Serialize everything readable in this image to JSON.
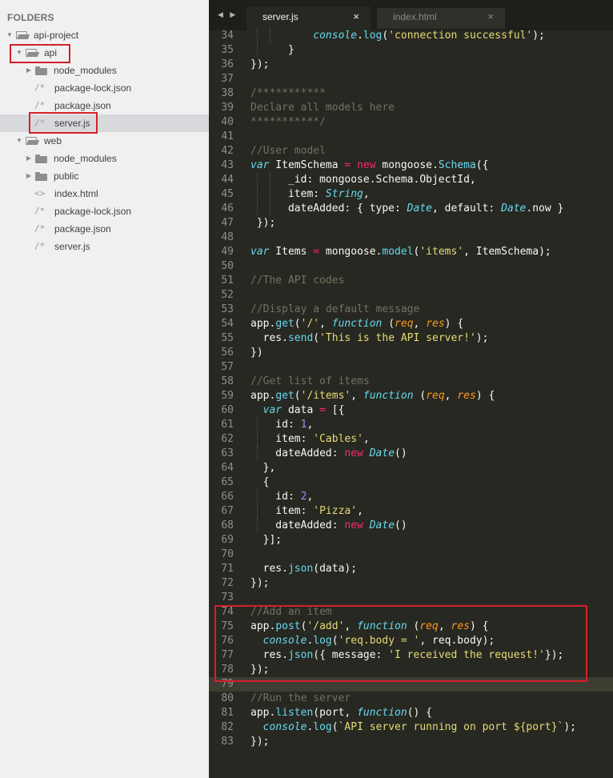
{
  "sidebar": {
    "header": "FOLDERS",
    "items": [
      {
        "label": "api-project",
        "kind": "folder-open",
        "depth": 0
      },
      {
        "label": "api",
        "kind": "folder-open",
        "depth": 1
      },
      {
        "label": "node_modules",
        "kind": "folder-closed",
        "depth": 2
      },
      {
        "label": "package-lock.json",
        "kind": "file",
        "depth": 2
      },
      {
        "label": "package.json",
        "kind": "file",
        "depth": 2
      },
      {
        "label": "server.js",
        "kind": "file",
        "depth": 2,
        "selected": true
      },
      {
        "label": "web",
        "kind": "folder-open",
        "depth": 1
      },
      {
        "label": "node_modules",
        "kind": "folder-closed",
        "depth": 2
      },
      {
        "label": "public",
        "kind": "folder-closed",
        "depth": 2
      },
      {
        "label": "index.html",
        "kind": "html-file",
        "depth": 2
      },
      {
        "label": "package-lock.json",
        "kind": "file",
        "depth": 2
      },
      {
        "label": "package.json",
        "kind": "file",
        "depth": 2
      },
      {
        "label": "server.js",
        "kind": "file",
        "depth": 2
      }
    ]
  },
  "icons": {
    "file": "/*",
    "html_file": "<>",
    "close": "×",
    "nav": "◀ ▶"
  },
  "tabs": [
    {
      "label": "server.js",
      "active": true
    },
    {
      "label": "index.html",
      "active": false
    }
  ],
  "editor": {
    "current_line": "79",
    "lines": [
      {
        "num": "34",
        "tokens": [
          [
            "",
            "          "
          ],
          [
            "it",
            "console"
          ],
          [
            "",
            "."
          ],
          [
            "f",
            "log"
          ],
          [
            "",
            "("
          ],
          [
            "s",
            "'connection successful'"
          ],
          [
            "",
            ");"
          ]
        ]
      },
      {
        "num": "35",
        "tokens": [
          [
            "",
            "      }"
          ]
        ]
      },
      {
        "num": "36",
        "tokens": [
          [
            "",
            "});"
          ]
        ]
      },
      {
        "num": "37",
        "tokens": []
      },
      {
        "num": "38",
        "tokens": [
          [
            "c",
            "/***********"
          ]
        ]
      },
      {
        "num": "39",
        "tokens": [
          [
            "c",
            "Declare all models here"
          ]
        ]
      },
      {
        "num": "40",
        "tokens": [
          [
            "c",
            "***********/"
          ]
        ]
      },
      {
        "num": "41",
        "tokens": []
      },
      {
        "num": "42",
        "tokens": [
          [
            "c",
            "//User model"
          ]
        ]
      },
      {
        "num": "43",
        "tokens": [
          [
            "it",
            "var"
          ],
          [
            "",
            " ItemSchema "
          ],
          [
            "k",
            "="
          ],
          [
            "",
            " "
          ],
          [
            "k",
            "new"
          ],
          [
            "",
            " mongoose."
          ],
          [
            "f",
            "Schema"
          ],
          [
            "",
            "({"
          ]
        ]
      },
      {
        "num": "44",
        "tokens": [
          [
            "",
            "      _id: mongoose.Schema.ObjectId,"
          ]
        ]
      },
      {
        "num": "45",
        "tokens": [
          [
            "",
            "      item: "
          ],
          [
            "it",
            "String"
          ],
          [
            "",
            ","
          ]
        ]
      },
      {
        "num": "46",
        "tokens": [
          [
            "",
            "      dateAdded: { type: "
          ],
          [
            "it",
            "Date"
          ],
          [
            "",
            ", default: "
          ],
          [
            "it",
            "Date"
          ],
          [
            "",
            ".now }"
          ]
        ]
      },
      {
        "num": "47",
        "tokens": [
          [
            "",
            " });"
          ]
        ]
      },
      {
        "num": "48",
        "tokens": []
      },
      {
        "num": "49",
        "tokens": [
          [
            "it",
            "var"
          ],
          [
            "",
            " Items "
          ],
          [
            "k",
            "="
          ],
          [
            "",
            " mongoose."
          ],
          [
            "f",
            "model"
          ],
          [
            "",
            "("
          ],
          [
            "s",
            "'items'"
          ],
          [
            "",
            ", ItemSchema);"
          ]
        ]
      },
      {
        "num": "50",
        "tokens": []
      },
      {
        "num": "51",
        "tokens": [
          [
            "c",
            "//The API codes"
          ]
        ]
      },
      {
        "num": "52",
        "tokens": []
      },
      {
        "num": "53",
        "tokens": [
          [
            "c",
            "//Display a default message"
          ]
        ]
      },
      {
        "num": "54",
        "tokens": [
          [
            "",
            "app."
          ],
          [
            "f",
            "get"
          ],
          [
            "",
            "("
          ],
          [
            "s",
            "'/'"
          ],
          [
            "",
            ", "
          ],
          [
            "it",
            "function"
          ],
          [
            "",
            " ("
          ],
          [
            "p",
            "req"
          ],
          [
            "",
            ", "
          ],
          [
            "p",
            "res"
          ],
          [
            "",
            ") {"
          ]
        ]
      },
      {
        "num": "55",
        "tokens": [
          [
            "",
            "  res."
          ],
          [
            "f",
            "send"
          ],
          [
            "",
            "("
          ],
          [
            "s",
            "'This is the API server!'"
          ],
          [
            "",
            ");"
          ]
        ]
      },
      {
        "num": "56",
        "tokens": [
          [
            "",
            "})"
          ]
        ]
      },
      {
        "num": "57",
        "tokens": []
      },
      {
        "num": "58",
        "tokens": [
          [
            "c",
            "//Get list of items"
          ]
        ]
      },
      {
        "num": "59",
        "tokens": [
          [
            "",
            "app."
          ],
          [
            "f",
            "get"
          ],
          [
            "",
            "("
          ],
          [
            "s",
            "'/items'"
          ],
          [
            "",
            ", "
          ],
          [
            "it",
            "function"
          ],
          [
            "",
            " ("
          ],
          [
            "p",
            "req"
          ],
          [
            "",
            ", "
          ],
          [
            "p",
            "res"
          ],
          [
            "",
            ") {"
          ]
        ]
      },
      {
        "num": "60",
        "tokens": [
          [
            "",
            "  "
          ],
          [
            "it",
            "var"
          ],
          [
            "",
            " data "
          ],
          [
            "k",
            "="
          ],
          [
            "",
            " [{"
          ]
        ]
      },
      {
        "num": "61",
        "tokens": [
          [
            "",
            "    id: "
          ],
          [
            "n",
            "1"
          ],
          [
            "",
            ","
          ]
        ]
      },
      {
        "num": "62",
        "tokens": [
          [
            "",
            "    item: "
          ],
          [
            "s",
            "'Cables'"
          ],
          [
            "",
            ","
          ]
        ]
      },
      {
        "num": "63",
        "tokens": [
          [
            "",
            "    dateAdded: "
          ],
          [
            "k",
            "new"
          ],
          [
            "",
            " "
          ],
          [
            "it",
            "Date"
          ],
          [
            "",
            "()"
          ]
        ]
      },
      {
        "num": "64",
        "tokens": [
          [
            "",
            "  },"
          ]
        ]
      },
      {
        "num": "65",
        "tokens": [
          [
            "",
            "  {"
          ]
        ]
      },
      {
        "num": "66",
        "tokens": [
          [
            "",
            "    id: "
          ],
          [
            "n",
            "2"
          ],
          [
            "",
            ","
          ]
        ]
      },
      {
        "num": "67",
        "tokens": [
          [
            "",
            "    item: "
          ],
          [
            "s",
            "'Pizza'"
          ],
          [
            "",
            ","
          ]
        ]
      },
      {
        "num": "68",
        "tokens": [
          [
            "",
            "    dateAdded: "
          ],
          [
            "k",
            "new"
          ],
          [
            "",
            " "
          ],
          [
            "it",
            "Date"
          ],
          [
            "",
            "()"
          ]
        ]
      },
      {
        "num": "69",
        "tokens": [
          [
            "",
            "  }];"
          ]
        ]
      },
      {
        "num": "70",
        "tokens": []
      },
      {
        "num": "71",
        "tokens": [
          [
            "",
            "  res."
          ],
          [
            "f",
            "json"
          ],
          [
            "",
            "(data);"
          ]
        ]
      },
      {
        "num": "72",
        "tokens": [
          [
            "",
            "});"
          ]
        ]
      },
      {
        "num": "73",
        "tokens": []
      },
      {
        "num": "74",
        "tokens": [
          [
            "c",
            "//Add an item"
          ]
        ]
      },
      {
        "num": "75",
        "tokens": [
          [
            "",
            "app."
          ],
          [
            "f",
            "post"
          ],
          [
            "",
            "("
          ],
          [
            "s",
            "'/add'"
          ],
          [
            "",
            ", "
          ],
          [
            "it",
            "function"
          ],
          [
            "",
            " ("
          ],
          [
            "p",
            "req"
          ],
          [
            "",
            ", "
          ],
          [
            "p",
            "res"
          ],
          [
            "",
            ") {"
          ]
        ]
      },
      {
        "num": "76",
        "tokens": [
          [
            "",
            "  "
          ],
          [
            "it",
            "console"
          ],
          [
            "",
            "."
          ],
          [
            "f",
            "log"
          ],
          [
            "",
            "("
          ],
          [
            "s",
            "'req.body = '"
          ],
          [
            "",
            ", req.body);"
          ]
        ]
      },
      {
        "num": "77",
        "tokens": [
          [
            "",
            "  res."
          ],
          [
            "f",
            "json"
          ],
          [
            "",
            "({ message: "
          ],
          [
            "s",
            "'I received the request!'"
          ],
          [
            "",
            "});"
          ]
        ]
      },
      {
        "num": "78",
        "tokens": [
          [
            "",
            "});"
          ]
        ]
      },
      {
        "num": "79",
        "tokens": []
      },
      {
        "num": "80",
        "tokens": [
          [
            "c",
            "//Run the server"
          ]
        ]
      },
      {
        "num": "81",
        "tokens": [
          [
            "",
            "app."
          ],
          [
            "f",
            "listen"
          ],
          [
            "",
            "(port, "
          ],
          [
            "it",
            "function"
          ],
          [
            "",
            "() {"
          ]
        ]
      },
      {
        "num": "82",
        "tokens": [
          [
            "",
            "  "
          ],
          [
            "it",
            "console"
          ],
          [
            "",
            "."
          ],
          [
            "f",
            "log"
          ],
          [
            "",
            "("
          ],
          [
            "s",
            "`API server running on port ${port}`"
          ],
          [
            "",
            ");"
          ]
        ]
      },
      {
        "num": "83",
        "tokens": [
          [
            "",
            "});"
          ]
        ]
      }
    ]
  },
  "colors": {
    "editor_bg": "#272822",
    "sidebar_bg": "#f0f0f0",
    "annotation_red": "#d4202a"
  }
}
